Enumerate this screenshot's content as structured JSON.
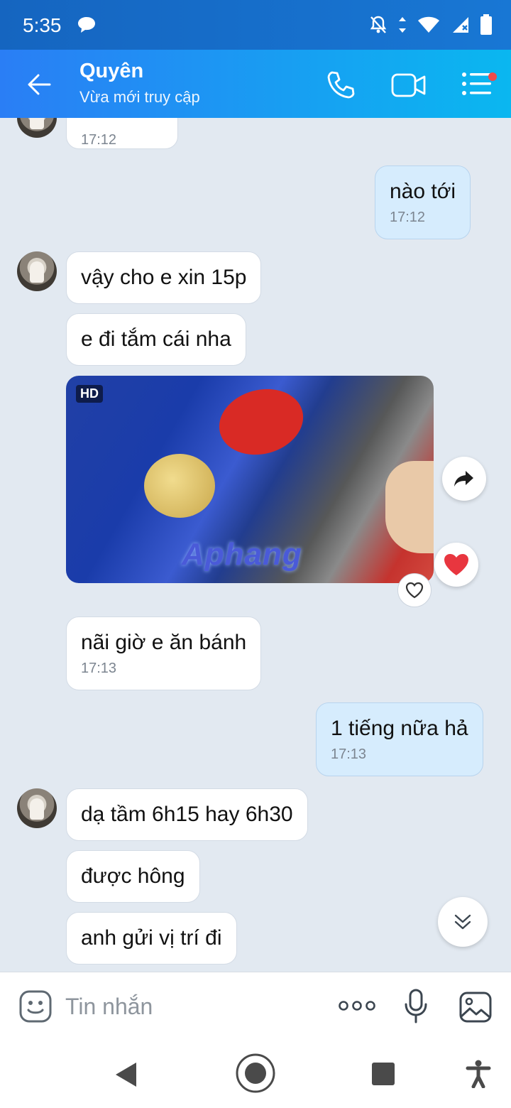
{
  "status_bar": {
    "time": "5:35"
  },
  "header": {
    "contact_name": "Quyên",
    "contact_status": "Vừa mới truy cập"
  },
  "messages": [
    {
      "from": "them",
      "text": "",
      "time": "17:12"
    },
    {
      "from": "me",
      "text": "nào tới",
      "time": "17:12"
    },
    {
      "from": "them",
      "text": "vậy cho e xin 15p"
    },
    {
      "from": "them",
      "text": "e đi tắm cái nha"
    },
    {
      "from": "them",
      "type": "photo",
      "badge": "HD",
      "watermark": "Aphang",
      "reaction": "heart"
    },
    {
      "from": "them",
      "text": "nãi giờ e ăn bánh",
      "time": "17:13"
    },
    {
      "from": "me",
      "text": "1 tiếng nữa hả",
      "time": "17:13"
    },
    {
      "from": "them",
      "text": "dạ tầm 6h15 hay 6h30"
    },
    {
      "from": "them",
      "text": "được hông"
    },
    {
      "from": "them",
      "text": "anh gửi vị trí đi"
    }
  ],
  "composer": {
    "placeholder": "Tin nhắn",
    "value": ""
  },
  "colors": {
    "header_start": "#2a7ef5",
    "header_end": "#0ab7f0",
    "my_bubble": "#d6ecfd",
    "chat_bg": "#e2e9f1",
    "heart": "#e8363f",
    "notification_dot": "#f04a4a"
  }
}
